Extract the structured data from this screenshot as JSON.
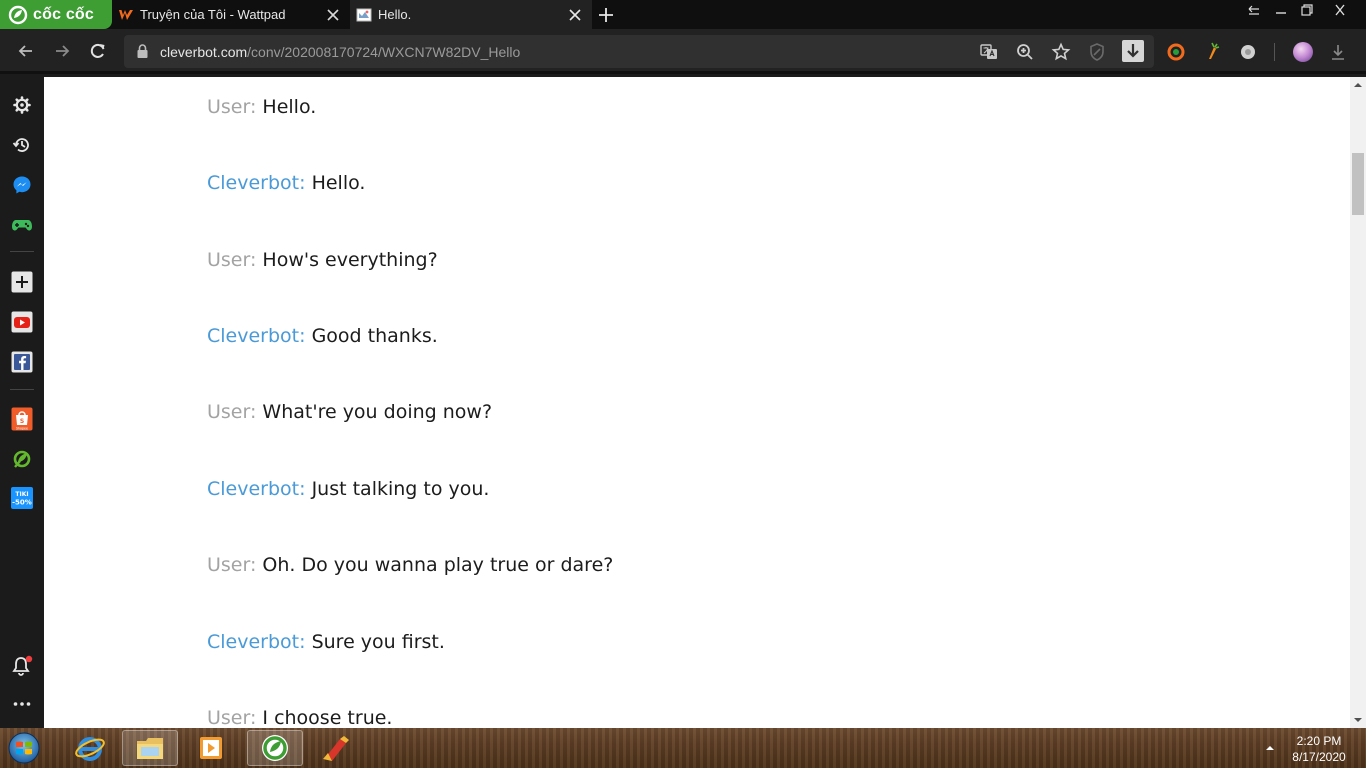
{
  "browser": {
    "brand_name": "cốc cốc",
    "tabs": [
      {
        "title": "Truyện của Tôi - Wattpad"
      },
      {
        "title": "Hello."
      }
    ],
    "address": {
      "host": "cleverbot.com",
      "path": "/conv/202008170724/WXCN7W82DV_Hello"
    }
  },
  "conversation": [
    {
      "speaker": "User:",
      "text": "Hello.",
      "role": "user"
    },
    {
      "speaker": "Cleverbot:",
      "text": "Hello.",
      "role": "bot"
    },
    {
      "speaker": "User:",
      "text": "How's everything?",
      "role": "user"
    },
    {
      "speaker": "Cleverbot:",
      "text": "Good thanks.",
      "role": "bot"
    },
    {
      "speaker": "User:",
      "text": "What're you doing now?",
      "role": "user"
    },
    {
      "speaker": "Cleverbot:",
      "text": "Just talking to you.",
      "role": "bot"
    },
    {
      "speaker": "User:",
      "text": "Oh. Do you wanna play true or dare?",
      "role": "user"
    },
    {
      "speaker": "Cleverbot:",
      "text": "Sure you first.",
      "role": "bot"
    },
    {
      "speaker": "User:",
      "text": "I choose true.",
      "role": "user"
    }
  ],
  "sidebar": {
    "icons": [
      "gear-icon",
      "history-icon",
      "messenger-icon",
      "gamepad-icon",
      "add-icon",
      "youtube-icon",
      "facebook-icon",
      "shopee-icon",
      "coccoc-leaf-icon",
      "tiki-icon",
      "bell-icon",
      "more-icon"
    ],
    "tiki_badge": "TIKI",
    "tiki_discount": "-50%",
    "shopee_label": "Shopee"
  },
  "taskbar": {
    "time": "2:20 PM",
    "date": "8/17/2020"
  },
  "colors": {
    "user_speaker": "#a3a3a3",
    "bot_speaker": "#4a9ad8",
    "brand_green": "#3e9e34"
  }
}
